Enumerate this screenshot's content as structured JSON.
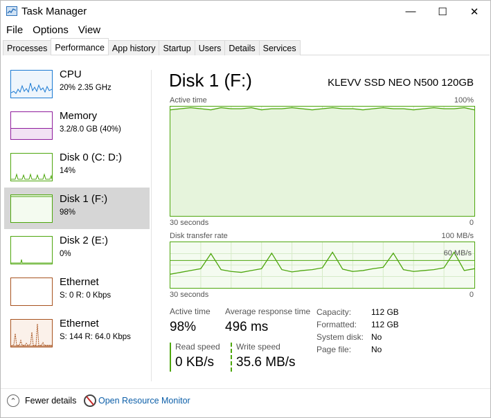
{
  "window": {
    "title": "Task Manager",
    "minimize": "—",
    "maximize": "☐",
    "close": "✕"
  },
  "menu": [
    "File",
    "Options",
    "View"
  ],
  "tabs": [
    "Processes",
    "Performance",
    "App history",
    "Startup",
    "Users",
    "Details",
    "Services"
  ],
  "active_tab": "Performance",
  "sidebar": [
    {
      "name": "CPU",
      "sub": "20%  2.35 GHz",
      "color": "#1b7ad3",
      "selected": false
    },
    {
      "name": "Memory",
      "sub": "3.2/8.0 GB (40%)",
      "color": "#8e1b9c",
      "selected": false
    },
    {
      "name": "Disk 0 (C: D:)",
      "sub": "14%",
      "color": "#4da60c",
      "selected": false
    },
    {
      "name": "Disk 1 (F:)",
      "sub": "98%",
      "color": "#4da60c",
      "selected": true
    },
    {
      "name": "Disk 2 (E:)",
      "sub": "0%",
      "color": "#4da60c",
      "selected": false
    },
    {
      "name": "Ethernet",
      "sub": "S: 0  R: 0 Kbps",
      "color": "#a7521e",
      "selected": false
    },
    {
      "name": "Ethernet",
      "sub": "S: 144  R: 64.0 Kbps",
      "color": "#a7521e",
      "selected": false
    }
  ],
  "detail": {
    "title": "Disk 1 (F:)",
    "device": "KLEVV SSD NEO N500 120GB",
    "chart1": {
      "label": "Active time",
      "max": "100%",
      "time_label": "30 seconds",
      "min": "0"
    },
    "chart2": {
      "label": "Disk transfer rate",
      "max": "100 MB/s",
      "mid": "60 MB/s",
      "time_label": "30 seconds",
      "min": "0"
    },
    "stats": {
      "active_time_label": "Active time",
      "active_time_value": "98%",
      "response_label": "Average response time",
      "response_value": "496 ms",
      "read_label": "Read speed",
      "read_value": "0 KB/s",
      "write_label": "Write speed",
      "write_value": "35.6 MB/s"
    },
    "properties": [
      {
        "key": "Capacity:",
        "value": "112 GB"
      },
      {
        "key": "Formatted:",
        "value": "112 GB"
      },
      {
        "key": "System disk:",
        "value": "No"
      },
      {
        "key": "Page file:",
        "value": "No"
      }
    ]
  },
  "chart_data": {
    "active_time_pct": [
      97,
      98,
      99,
      98,
      97,
      99,
      98,
      98,
      99,
      97,
      98,
      98,
      99,
      98,
      97,
      98,
      99,
      98,
      98,
      97,
      98,
      99,
      98,
      98,
      97,
      98,
      99,
      98,
      98,
      99,
      97
    ],
    "transfer_rate_mbps": [
      30,
      34,
      38,
      42,
      75,
      40,
      36,
      34,
      38,
      42,
      76,
      40,
      35,
      38,
      40,
      44,
      78,
      41,
      36,
      38,
      42,
      45,
      76,
      40,
      36,
      38,
      40,
      44,
      78,
      38,
      42
    ],
    "sidebar_colors": {
      "cpu": "#1b7ad3",
      "memory": "#8e1b9c",
      "disk": "#4da60c",
      "ethernet": "#a7521e"
    }
  },
  "footer": {
    "fewer_details": "Fewer details",
    "resource_monitor": "Open Resource Monitor"
  }
}
